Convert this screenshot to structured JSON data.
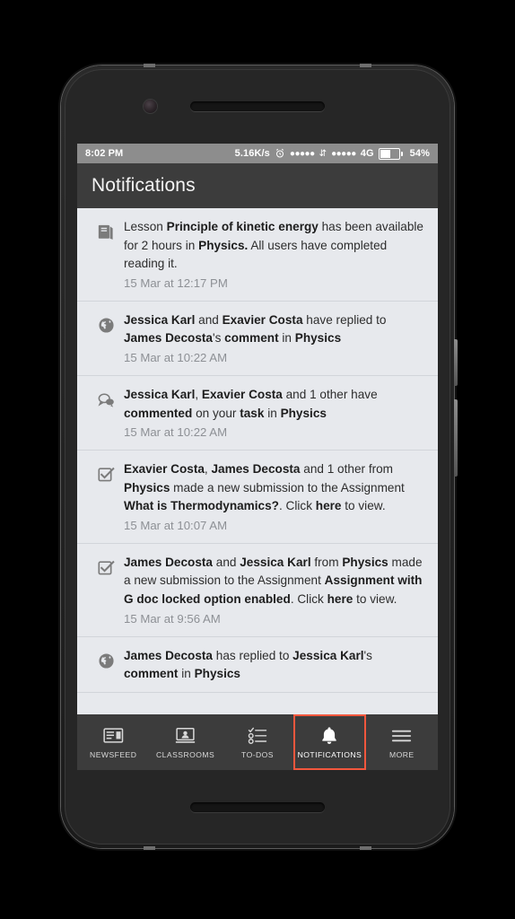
{
  "status_bar": {
    "time": "8:02 PM",
    "network_speed": "5.16K/s",
    "alarm_icon": "alarm-clock-icon",
    "sim1_signal": "●●●●●",
    "data_transfer_icon": "⇵",
    "sim2_signal": "●●●●●",
    "network_type": "4G",
    "battery_percent": "54%"
  },
  "app_bar": {
    "title": "Notifications"
  },
  "notifications": [
    {
      "icon": "lesson-book-icon",
      "html": "Lesson <b>Principle of kinetic energy</b> has been available for 2 hours in <b>Physics.</b> All users have completed reading it.",
      "time": "15 Mar at 12:17 PM"
    },
    {
      "icon": "globe-icon",
      "html": "<b>Jessica Karl</b> and <b>Exavier Costa</b> have replied to <b>James Decosta</b>'s <b>comment</b> in <b>Physics</b>",
      "time": "15 Mar at 10:22 AM"
    },
    {
      "icon": "comment-bubbles-icon",
      "html": "<b>Jessica Karl</b>, <b>Exavier Costa</b> and 1 other have <b>commented</b> on your <b>task</b> in <b>Physics</b>",
      "time": "15 Mar at 10:22 AM"
    },
    {
      "icon": "checkbox-checked-icon",
      "html": "<b>Exavier Costa</b>, <b>James Decosta</b> and 1 other from <b>Physics</b> made a new submission to the Assignment <b>What is Thermodynamics?</b>. Click <b>here</b> to view.",
      "time": "15 Mar at 10:07 AM"
    },
    {
      "icon": "checkbox-checked-icon",
      "html": "<b>James Decosta</b> and <b>Jessica Karl</b> from <b>Physics</b> made a new submission to the Assignment <b>Assignment with G doc locked option enabled</b>. Click <b>here</b> to view.",
      "time": "15 Mar at 9:56 AM"
    },
    {
      "icon": "globe-icon",
      "html": "<b>James Decosta</b> has replied to <b>Jessica Karl</b>'s <b>comment</b> in <b>Physics</b>",
      "time": ""
    }
  ],
  "bottom_nav": {
    "active_index": 3,
    "active_outline_color": "#f2573d",
    "items": [
      {
        "label": "NEWSFEED",
        "icon": "newsfeed-icon"
      },
      {
        "label": "CLASSROOMS",
        "icon": "classrooms-icon"
      },
      {
        "label": "TO-DOS",
        "icon": "todos-checklist-icon"
      },
      {
        "label": "NOTIFICATIONS",
        "icon": "bell-icon"
      },
      {
        "label": "MORE",
        "icon": "hamburger-menu-icon"
      }
    ]
  }
}
